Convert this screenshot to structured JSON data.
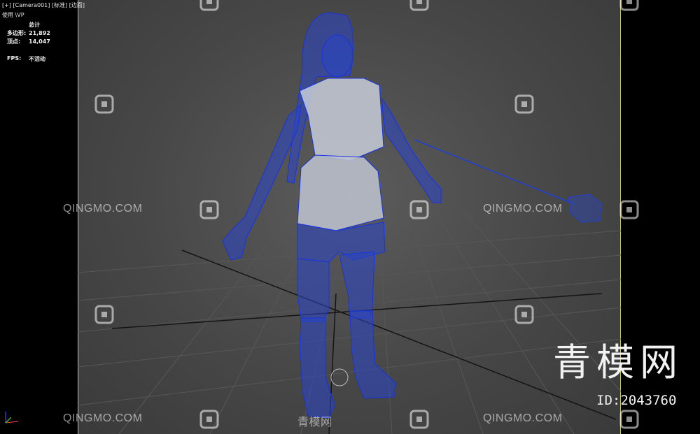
{
  "viewport": {
    "label": "[+] [Camera001] [标准] [边面]",
    "sub_label": "使用 \\VP",
    "stats": {
      "header": "总计",
      "polys_label": "多边形:",
      "polys_value": "21,892",
      "verts_label": "顶点:",
      "verts_value": "14,047",
      "fps_label": "FPS:",
      "fps_value": "不活动"
    }
  },
  "watermarks": {
    "site_text": "QINGMO.COM",
    "cn_text": "青模网",
    "brand": "青模网",
    "id_text": "ID:2043760"
  },
  "colors": {
    "wire": "#1f3fd6",
    "grid_major": "#111111",
    "grid_minor": "#555555",
    "safe_frame": "#c8c870"
  }
}
